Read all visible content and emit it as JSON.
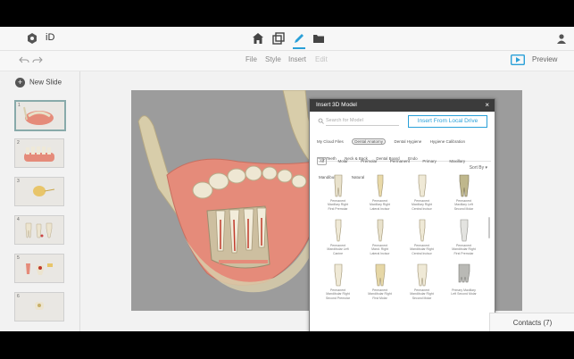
{
  "topbar": {
    "brand": "iD"
  },
  "toolbar": {
    "menu": [
      "File",
      "Style",
      "Insert",
      "Edit"
    ],
    "preview_label": "Preview"
  },
  "sidebar": {
    "new_slide_label": "New Slide",
    "slides": [
      "1",
      "2",
      "3",
      "4",
      "5",
      "6"
    ]
  },
  "modal": {
    "title": "Insert 3D Model",
    "close_label": "×",
    "search_placeholder": "Search for Model",
    "insert_local_label": "Insert From Local Drive",
    "tags": [
      "My Cloud Files",
      "Dental Anatomy",
      "Dental Hygiene",
      "Hygiene Calibration",
      "Prep Teeth",
      "Neck & Back",
      "Dental Board",
      "Endo"
    ],
    "active_tag": "Dental Anatomy",
    "filters": [
      "All",
      "Molar",
      "Premolar",
      "Permanent",
      "Primary",
      "Maxillary",
      "Mandibular",
      "Natural"
    ],
    "active_filter": "All",
    "sort_label": "Sort By ▾",
    "models": [
      {
        "l1": "Permanent",
        "l2": "Maxillary Right",
        "l3": "First Premolar"
      },
      {
        "l1": "Permanent",
        "l2": "Maxillary Right",
        "l3": "Lateral Incisor"
      },
      {
        "l1": "Permanent",
        "l2": "Maxillary Right",
        "l3": "Central Incisor"
      },
      {
        "l1": "Permanent",
        "l2": "Maxillary Left",
        "l3": "Second Molar"
      },
      {
        "l1": "Permanent",
        "l2": "Mandibular Left",
        "l3": "Canine"
      },
      {
        "l1": "Permanent",
        "l2": "Mand. Right",
        "l3": "Lateral Incisor"
      },
      {
        "l1": "Permanent",
        "l2": "Mandibular Right",
        "l3": "Central Incisor"
      },
      {
        "l1": "Permanent",
        "l2": "Mandibular Right",
        "l3": "First Premolar"
      },
      {
        "l1": "Permanent",
        "l2": "Mandibular Right",
        "l3": "Second Premolar"
      },
      {
        "l1": "Permanent",
        "l2": "Mandibular Right",
        "l3": "First Molar"
      },
      {
        "l1": "Permanent",
        "l2": "Mandibular Right",
        "l3": "Second Molar"
      },
      {
        "l1": "Primary Maxillary",
        "l2": "Left Second Molar",
        "l3": ""
      }
    ]
  },
  "contacts_label": "Contacts (7)",
  "colors": {
    "accent": "#2aa0d8",
    "gum": "#e58b7a",
    "bone": "#d9cfb0"
  }
}
